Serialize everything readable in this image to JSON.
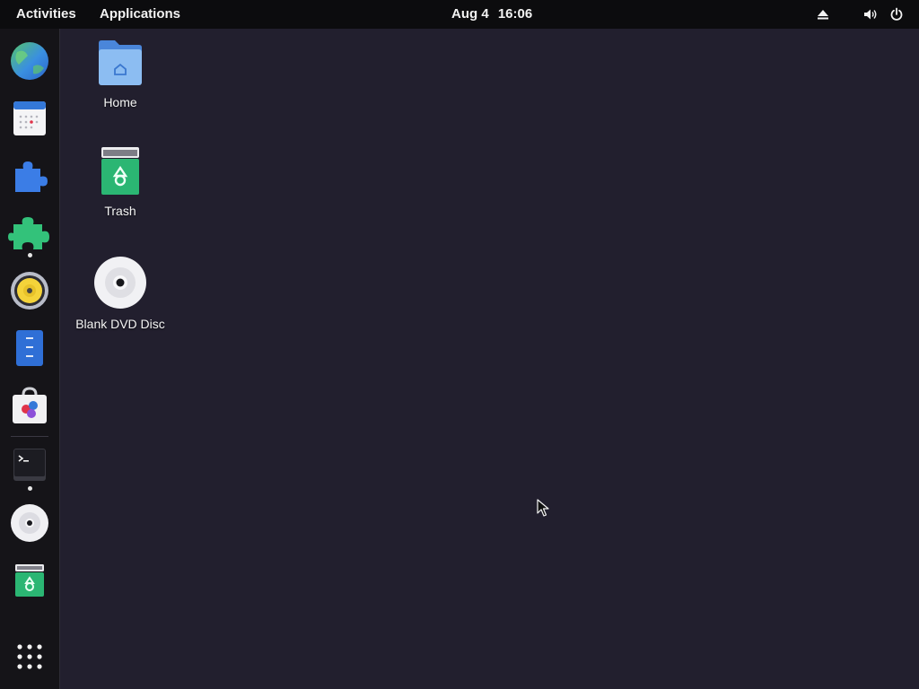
{
  "topbar": {
    "activities": "Activities",
    "applications": "Applications",
    "date": "Aug 4",
    "time": "16:06",
    "tray": [
      "eject-icon",
      "volume-icon",
      "power-icon"
    ]
  },
  "dash": {
    "apps": [
      {
        "name": "web-browser",
        "icon": "globe-icon",
        "running": false
      },
      {
        "name": "calendar",
        "icon": "calendar-icon",
        "running": false
      },
      {
        "name": "extensions",
        "icon": "puzzle-blue-icon",
        "running": false
      },
      {
        "name": "extension-manager",
        "icon": "puzzle-green-icon",
        "running": true
      },
      {
        "name": "audio-player",
        "icon": "speaker-icon",
        "running": false
      },
      {
        "name": "text-editor",
        "icon": "document-icon",
        "running": false
      },
      {
        "name": "software",
        "icon": "shopping-bag-icon",
        "running": false
      },
      {
        "name": "terminal",
        "icon": "terminal-icon",
        "running": true
      },
      {
        "name": "disc",
        "icon": "dvd-icon",
        "running": false
      },
      {
        "name": "trash",
        "icon": "trash-icon",
        "running": false
      }
    ],
    "show_apps_icon": "app-grid-icon"
  },
  "desktop": {
    "icons": [
      {
        "label": "Home",
        "icon": "home-folder-icon"
      },
      {
        "label": "Trash",
        "icon": "trash-icon"
      },
      {
        "label": "Blank DVD Disc",
        "icon": "dvd-disc-icon"
      }
    ]
  },
  "colors": {
    "background": "#221f2e",
    "topbar": "#0c0c0e",
    "dash": "#151418",
    "folder_blue": "#7fb2ee",
    "trash_green": "#2bb673"
  }
}
